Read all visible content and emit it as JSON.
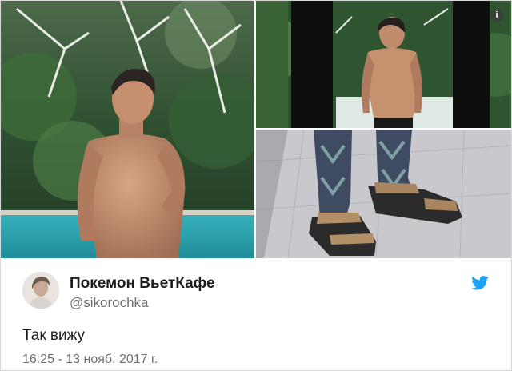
{
  "tweet": {
    "display_name": "Покемон ВьетКафе",
    "handle": "@sikorochka",
    "text": "Так вижу",
    "timestamp": "16:25 - 13 нояб. 2017 г."
  },
  "media": {
    "photos": [
      {
        "description": "photo-left"
      },
      {
        "description": "photo-top-right"
      },
      {
        "description": "photo-bottom-right"
      }
    ],
    "info_icon": "info-icon"
  },
  "icons": {
    "brand": "twitter-bird-icon",
    "avatar": "avatar"
  },
  "colors": {
    "twitter_blue": "#1da1f2",
    "name": "#1c1c1c",
    "secondary_text": "#707070",
    "border": "#d9d9d9"
  }
}
